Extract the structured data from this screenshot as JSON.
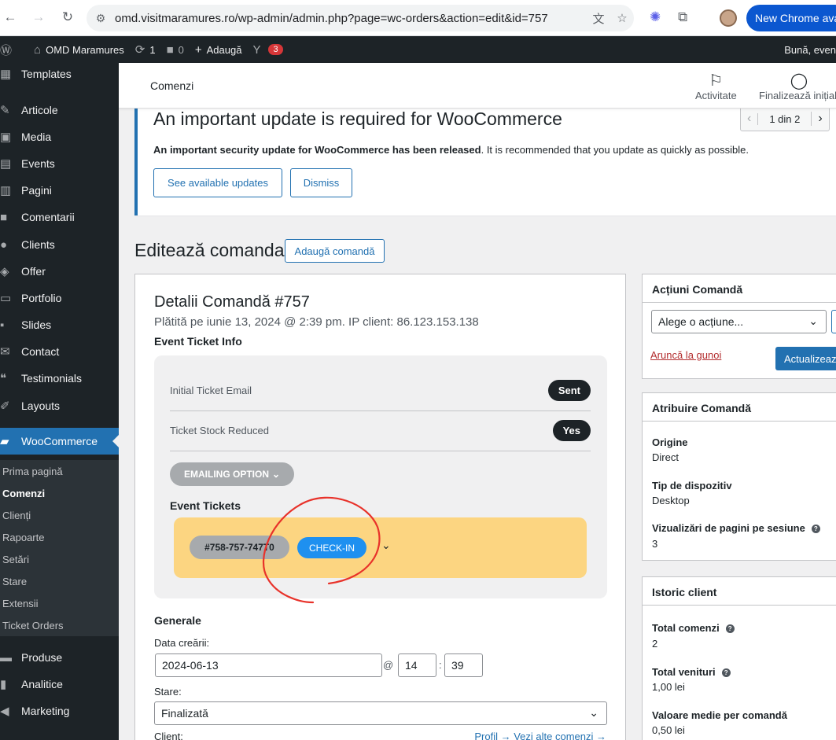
{
  "browser": {
    "url": "omd.visitmaramures.ro/wp-admin/admin.php?page=wc-orders&action=edit&id=757",
    "new_chrome_label": "New Chrome ava"
  },
  "adminbar": {
    "site_name": "OMD Maramures",
    "updates_count": "1",
    "comments_count": "0",
    "add_label": "Adaugă",
    "yoast_badge": "3",
    "greeting": "Bună, even"
  },
  "sidebar": {
    "items": [
      {
        "label": "Templates",
        "icon": "templates-icon"
      },
      {
        "label": "Articole",
        "icon": "pin-icon"
      },
      {
        "label": "Media",
        "icon": "media-icon"
      },
      {
        "label": "Events",
        "icon": "calendar-icon"
      },
      {
        "label": "Pagini",
        "icon": "pages-icon"
      },
      {
        "label": "Comentarii",
        "icon": "comment-icon"
      },
      {
        "label": "Clients",
        "icon": "user-icon"
      },
      {
        "label": "Offer",
        "icon": "tag-icon"
      },
      {
        "label": "Portfolio",
        "icon": "folder-icon"
      },
      {
        "label": "Slides",
        "icon": "slides-icon"
      },
      {
        "label": "Contact",
        "icon": "mail-icon"
      },
      {
        "label": "Testimonials",
        "icon": "quote-icon"
      },
      {
        "label": "Layouts",
        "icon": "brush-icon"
      }
    ],
    "woocommerce": "WooCommerce",
    "sub_items": [
      "Prima pagină",
      "Comenzi",
      "Clienți",
      "Rapoarte",
      "Setări",
      "Stare",
      "Extensii",
      "Ticket Orders"
    ],
    "bottom_items": [
      {
        "label": "Produse",
        "icon": "box-icon"
      },
      {
        "label": "Analitice",
        "icon": "chart-icon"
      },
      {
        "label": "Marketing",
        "icon": "megaphone-icon"
      }
    ]
  },
  "header": {
    "title": "Comenzi",
    "activity_label": "Activitate",
    "finish_label": "Finalizează inițiall"
  },
  "notice": {
    "title": "An important update is required for WooCommerce",
    "text_bold": "An important security update for WooCommerce has been released",
    "text_rest": ". It is recommended that you update as quickly as possible.",
    "primary_button": "See available updates",
    "dismiss_button": "Dismiss",
    "pager": "1 din 2"
  },
  "page": {
    "title": "Editează comanda",
    "add_button": "Adaugă comandă"
  },
  "order": {
    "title": "Detalii Comandă #757",
    "meta": "Plătită pe iunie 13, 2024 @ 2:39 pm. IP client: 86.123.153.138",
    "event_ticket_info": "Event Ticket Info",
    "rows": [
      {
        "label": "Initial Ticket Email",
        "value": "Sent"
      },
      {
        "label": "Ticket Stock Reduced",
        "value": "Yes"
      }
    ],
    "emailing_option": "EMAILING OPTION",
    "event_tickets_label": "Event Tickets",
    "ticket_id": "#758-757-747T0",
    "checkin_label": "CHECK-IN",
    "general_label": "Generale",
    "date_label": "Data creării:",
    "date_value": "2024-06-13",
    "hour_value": "14",
    "minute_value": "39",
    "status_label": "Stare:",
    "status_value": "Finalizată",
    "client_label": "Client:",
    "client_links": "Profil → Vezi alte comenzi →"
  },
  "actions_box": {
    "title": "Acțiuni Comandă",
    "select_value": "Alege o acțiune...",
    "trash_link": "Aruncă la gunoi",
    "update_button": "Actualizeaz"
  },
  "attribution_box": {
    "title": "Atribuire Comandă",
    "fields": [
      {
        "label": "Origine",
        "value": "Direct"
      },
      {
        "label": "Tip de dispozitiv",
        "value": "Desktop"
      },
      {
        "label": "Vizualizări de pagini pe sesiune",
        "value": "3"
      }
    ]
  },
  "history_box": {
    "title": "Istoric client",
    "fields": [
      {
        "label": "Total comenzi",
        "value": "2"
      },
      {
        "label": "Total venituri",
        "value": "1,00 lei"
      },
      {
        "label": "Valoare medie per comandă",
        "value": "0,50 lei"
      }
    ]
  },
  "colors": {
    "wp_dark": "#1d2327",
    "wp_blue": "#2271b1",
    "ticket_bg": "#fcd581",
    "checkin_blue": "#1e90f0",
    "annotation_red": "#e8322a"
  }
}
